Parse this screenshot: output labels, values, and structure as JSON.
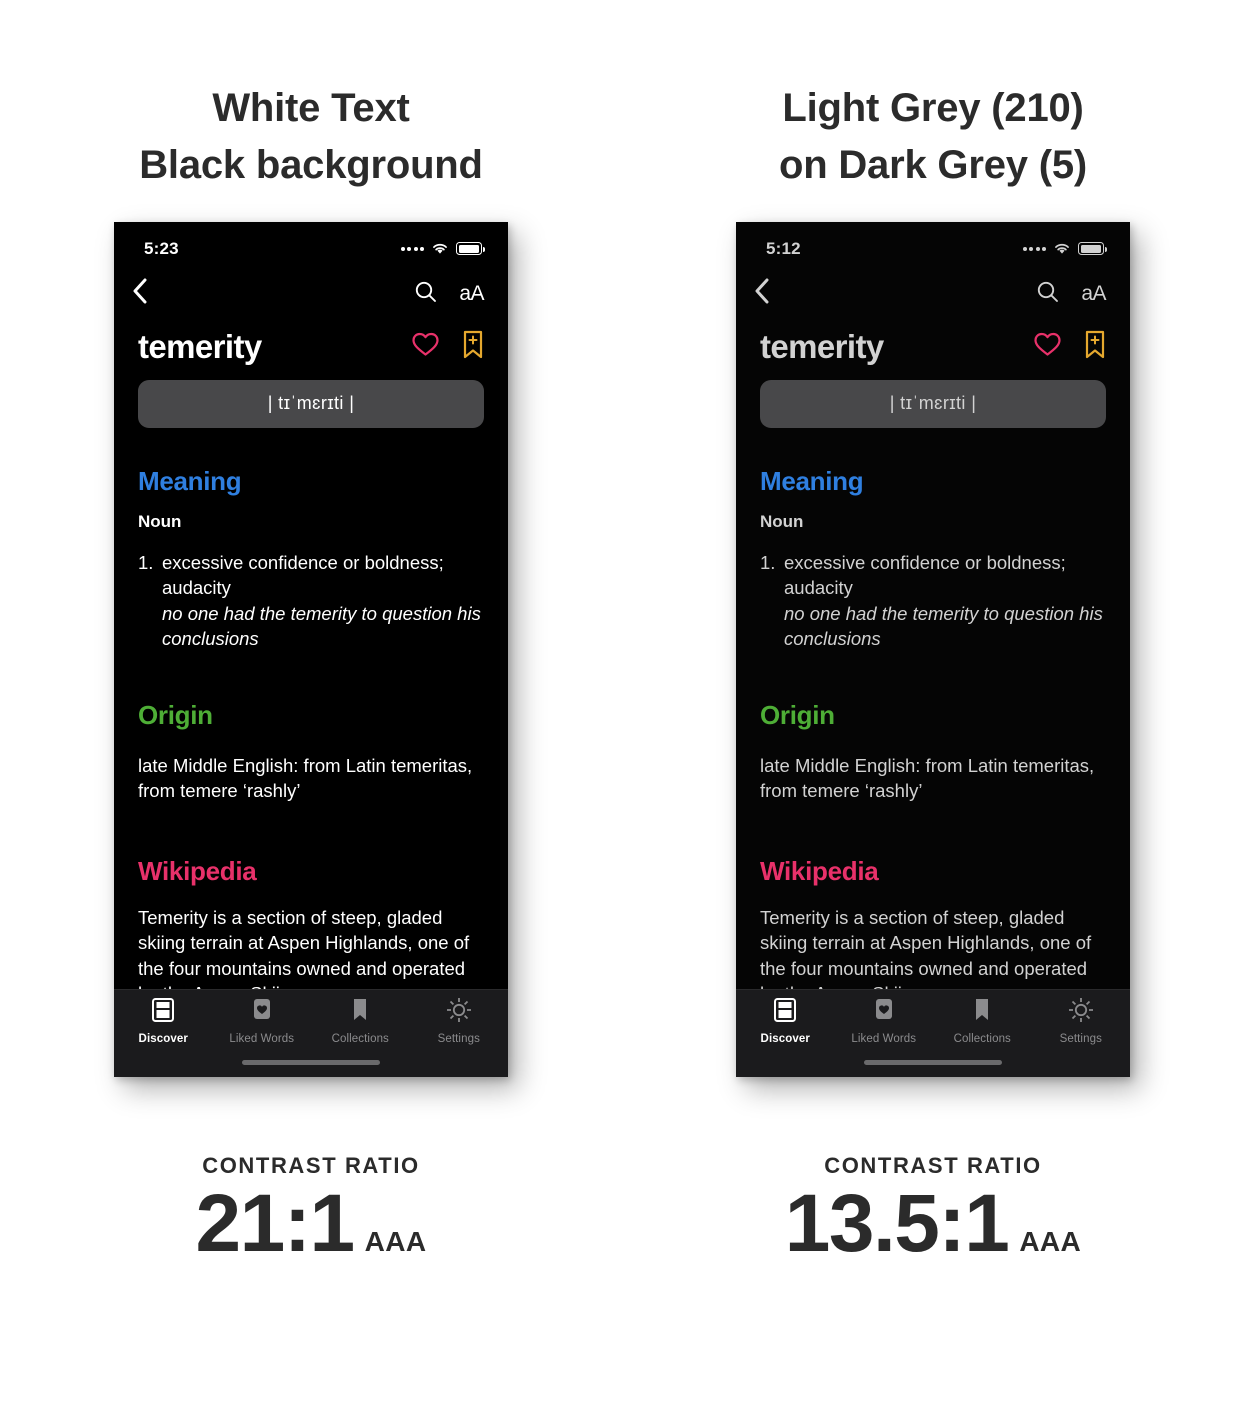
{
  "panels": [
    {
      "heading_line1": "White Text",
      "heading_line2": "Black background",
      "variant": "white",
      "screen": {
        "status": {
          "time": "5:23",
          "signal_icon": "signal-dots-icon",
          "wifi_icon": "wifi-icon",
          "battery_icon": "battery-icon"
        },
        "nav": {
          "back_icon": "chevron-left-icon",
          "search_icon": "search-icon",
          "text_size_label": "aA"
        },
        "word": {
          "title": "temerity",
          "like_icon": "heart-icon",
          "bookmark_icon": "bookmark-plus-icon",
          "phonetic": "| tɪˈmɛrɪti |"
        },
        "sections": {
          "meaning_title": "Meaning",
          "part_of_speech": "Noun",
          "definition_number": "1.",
          "definition": "excessive confidence or boldness; audacity",
          "definition_example": "no one had the temerity to question his conclusions",
          "origin_title": "Origin",
          "origin_text": "late Middle English: from Latin temeritas, from temere ‘rashly’",
          "wikipedia_title": "Wikipedia",
          "wikipedia_text": "Temerity is a section of steep, gladed skiing terrain at Aspen Highlands, one of the four mountains owned and operated by the Aspen Skiing"
        },
        "tabs": [
          {
            "label": "Discover",
            "icon": "book-icon",
            "active": true
          },
          {
            "label": "Liked Words",
            "icon": "heart-card-icon",
            "active": false
          },
          {
            "label": "Collections",
            "icon": "bookmark-icon",
            "active": false
          },
          {
            "label": "Settings",
            "icon": "gear-icon",
            "active": false
          }
        ]
      },
      "ratio_label": "CONTRAST RATIO",
      "ratio_value": "21:1",
      "ratio_level": "AAA"
    },
    {
      "heading_line1": "Light Grey (210)",
      "heading_line2": "on Dark Grey (5)",
      "variant": "grey",
      "screen": {
        "status": {
          "time": "5:12",
          "signal_icon": "signal-dots-icon",
          "wifi_icon": "wifi-icon",
          "battery_icon": "battery-icon"
        },
        "nav": {
          "back_icon": "chevron-left-icon",
          "search_icon": "search-icon",
          "text_size_label": "aA"
        },
        "word": {
          "title": "temerity",
          "like_icon": "heart-icon",
          "bookmark_icon": "bookmark-plus-icon",
          "phonetic": "| tɪˈmɛrɪti |"
        },
        "sections": {
          "meaning_title": "Meaning",
          "part_of_speech": "Noun",
          "definition_number": "1.",
          "definition": "excessive confidence or boldness; audacity",
          "definition_example": "no one had the temerity to question his conclusions",
          "origin_title": "Origin",
          "origin_text": "late Middle English: from Latin temeritas, from temere ‘rashly’",
          "wikipedia_title": "Wikipedia",
          "wikipedia_text": "Temerity is a section of steep, gladed skiing terrain at Aspen Highlands, one of the four mountains owned and operated by the Aspen Skiing"
        },
        "tabs": [
          {
            "label": "Discover",
            "icon": "book-icon",
            "active": true
          },
          {
            "label": "Liked Words",
            "icon": "heart-card-icon",
            "active": false
          },
          {
            "label": "Collections",
            "icon": "bookmark-icon",
            "active": false
          },
          {
            "label": "Settings",
            "icon": "gear-icon",
            "active": false
          }
        ]
      },
      "ratio_label": "CONTRAST RATIO",
      "ratio_value": "13.5:1",
      "ratio_level": "AAA"
    }
  ],
  "colors": {
    "page_background": "#ffffff",
    "heading_text": "#2b2b2b",
    "screen_black": "#000000",
    "screen_dark_grey": "#050505",
    "text_white": "#ffffff",
    "text_light_grey": "#d2d2d2",
    "meaning_blue": "#2f7fe0",
    "origin_green": "#4eae36",
    "wikipedia_pink": "#e8316a",
    "heart_pink": "#e8316a",
    "bookmark_gold": "#e5a82e",
    "phonetic_pill": "#48484a",
    "tabbar_background": "#1b1b1d",
    "tab_inactive": "#8b8b8d"
  }
}
